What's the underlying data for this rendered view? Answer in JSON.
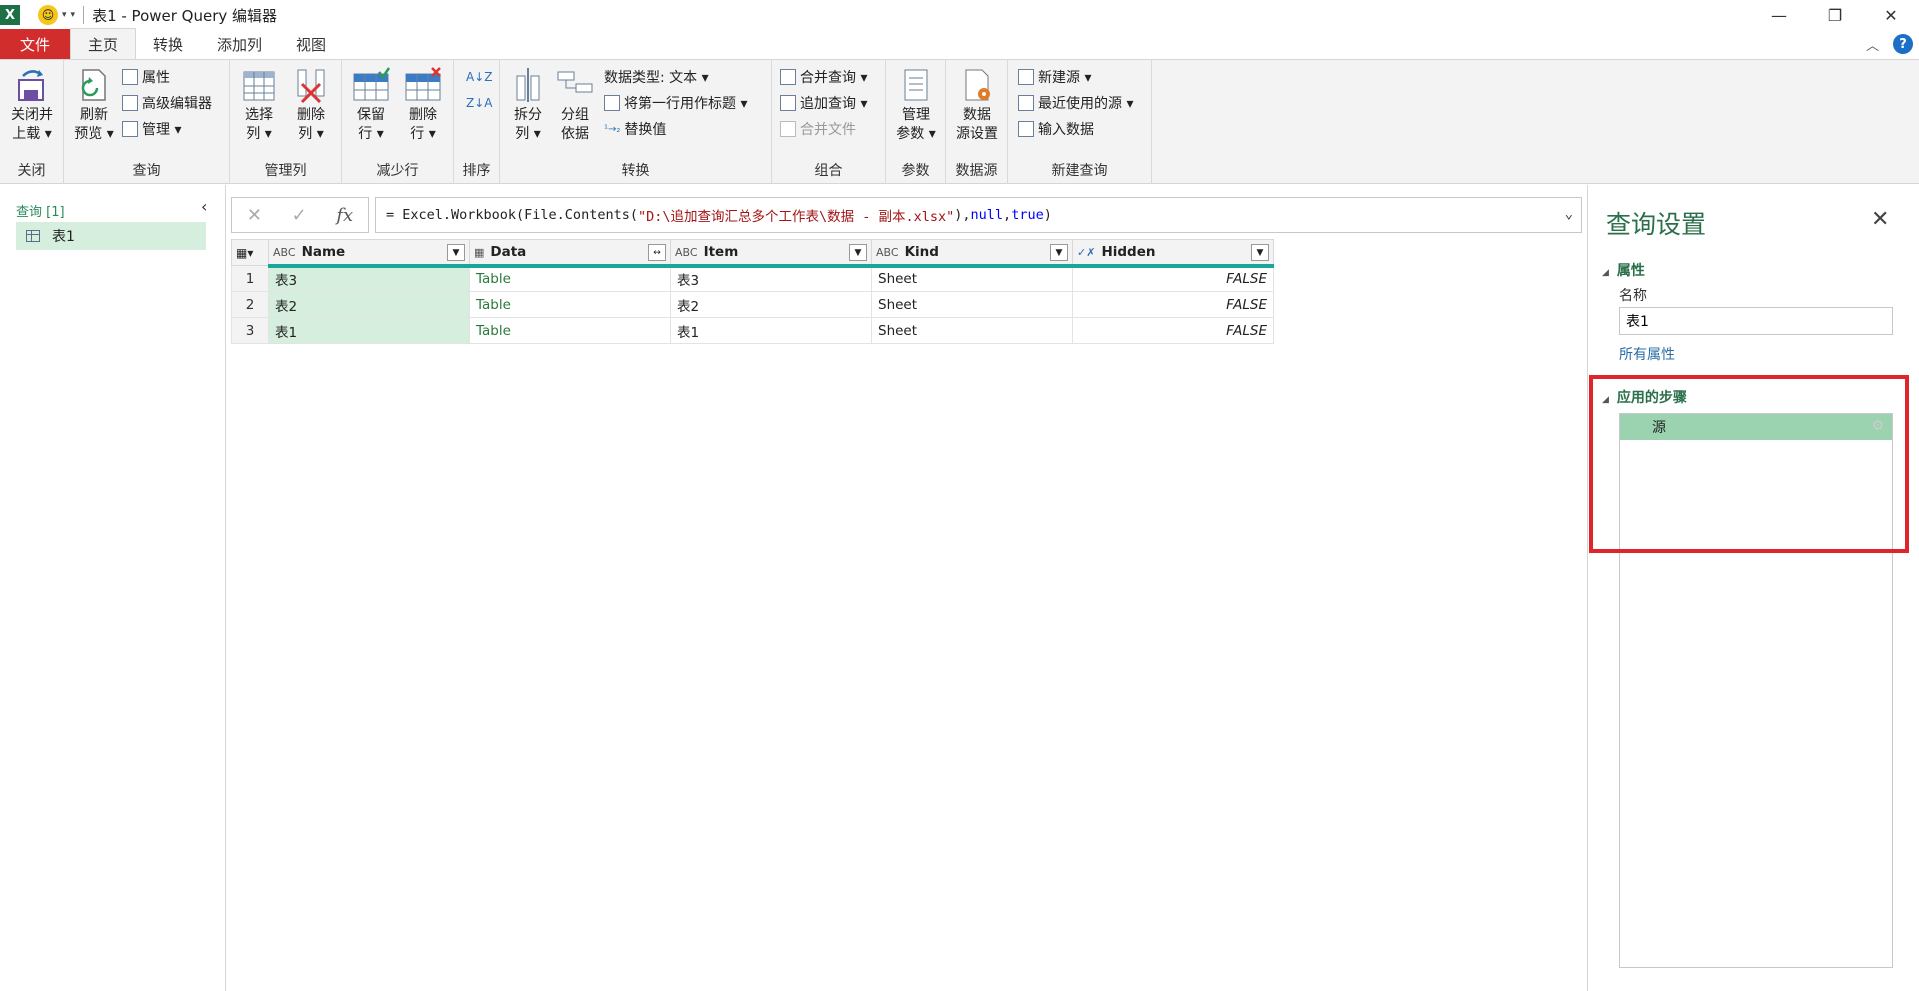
{
  "window": {
    "app_badge": "X",
    "title": "表1 - Power Query 编辑器",
    "minimize": "—",
    "restore": "❐",
    "close": "✕"
  },
  "tabs": [
    {
      "label": "文件"
    },
    {
      "label": "主页"
    },
    {
      "label": "转换"
    },
    {
      "label": "添加列"
    },
    {
      "label": "视图"
    }
  ],
  "help_label": "?",
  "ribbon": {
    "groups": {
      "close": "关闭",
      "query": "查询",
      "manage_cols": "管理列",
      "reduce_rows": "减少行",
      "sort": "排序",
      "transform": "转换",
      "combine": "组合",
      "params": "参数",
      "datasource": "数据源",
      "newquery": "新建查询"
    },
    "buttons": {
      "close_load_1": "关闭并",
      "close_load_2": "上载 ▾",
      "refresh_1": "刷新",
      "refresh_2": "预览 ▾",
      "properties": "属性",
      "adv_editor": "高级编辑器",
      "manage": "管理 ▾",
      "choose_cols_1": "选择",
      "choose_cols_2": "列 ▾",
      "remove_cols_1": "删除",
      "remove_cols_2": "列 ▾",
      "keep_rows_1": "保留",
      "keep_rows_2": "行 ▾",
      "remove_rows_1": "删除",
      "remove_rows_2": "行 ▾",
      "split_1": "拆分",
      "split_2": "列 ▾",
      "groupby_1": "分组",
      "groupby_2": "依据",
      "datatype": "数据类型: 文本 ▾",
      "first_row_header": "将第一行用作标题 ▾",
      "replace_values": "替换值",
      "merge_queries": "合并查询 ▾",
      "append_queries": "追加查询 ▾",
      "combine_files": "合并文件",
      "manage_params_1": "管理",
      "manage_params_2": "参数 ▾",
      "ds_settings_1": "数据",
      "ds_settings_2": "源设置",
      "new_source": "新建源 ▾",
      "recent_sources": "最近使用的源 ▾",
      "enter_data": "输入数据"
    }
  },
  "queries_pane": {
    "header": "查询 [1]",
    "items": [
      {
        "label": "表1"
      }
    ]
  },
  "formula": {
    "prefix": "= Excel.Workbook(File.Contents(",
    "path": "\"D:\\追加查询汇总多个工作表\\数据 - 副本.xlsx\"",
    "mid": "), ",
    "null_kw": "null",
    "comma": ", ",
    "true_kw": "true",
    "suffix": ")"
  },
  "table": {
    "columns": [
      {
        "type_icon": "ABC",
        "name": "Name"
      },
      {
        "type_icon": "▦",
        "name": "Data"
      },
      {
        "type_icon": "ABC",
        "name": "Item"
      },
      {
        "type_icon": "ABC",
        "name": "Kind"
      },
      {
        "type_icon": "✓✗",
        "name": "Hidden"
      }
    ],
    "rows": [
      {
        "n": "1",
        "Name": "表3",
        "Data": "Table",
        "Item": "表3",
        "Kind": "Sheet",
        "Hidden": "FALSE"
      },
      {
        "n": "2",
        "Name": "表2",
        "Data": "Table",
        "Item": "表2",
        "Kind": "Sheet",
        "Hidden": "FALSE"
      },
      {
        "n": "3",
        "Name": "表1",
        "Data": "Table",
        "Item": "表1",
        "Kind": "Sheet",
        "Hidden": "FALSE"
      }
    ]
  },
  "settings": {
    "title": "查询设置",
    "properties_header": "属性",
    "name_label": "名称",
    "name_value": "表1",
    "all_properties": "所有属性",
    "steps_header": "应用的步骤",
    "steps": [
      {
        "label": "源"
      }
    ]
  },
  "colors": {
    "accent_green": "#2a6f4a",
    "file_tab": "#d22d2d",
    "selection": "#d5eedd",
    "step_selected": "#9bd3b0",
    "highlight_box": "#e0242b",
    "column_bar": "#1aa79a"
  }
}
